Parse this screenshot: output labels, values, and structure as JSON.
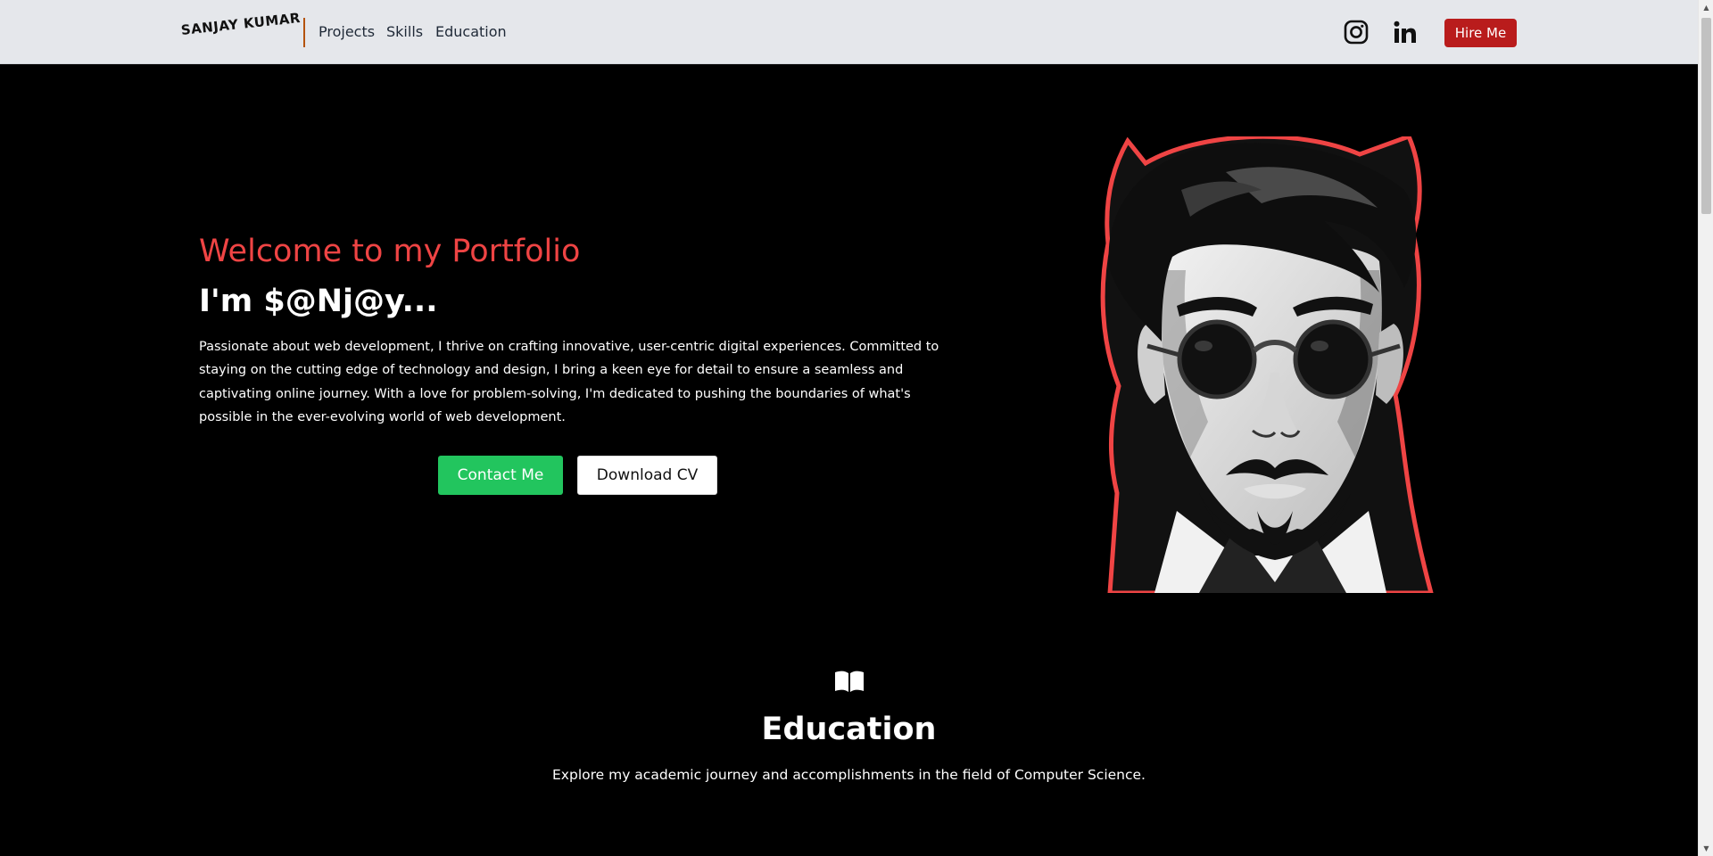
{
  "navbar": {
    "brand": "SANJAY KUMAR",
    "links": [
      {
        "label": "Projects"
      },
      {
        "label": "Skills"
      },
      {
        "label": "Education"
      }
    ],
    "social": [
      {
        "icon": "instagram-icon"
      },
      {
        "icon": "linkedin-icon"
      }
    ],
    "hire_label": "Hire Me",
    "background": "#e5e7eb",
    "hire_color": "#b91c1c"
  },
  "hero": {
    "welcome": "Welcome to my Portfolio",
    "name": "I'm $@Nj@y...",
    "intro": "Passionate about web development, I thrive on crafting innovative, user-centric digital experiences. Committed to staying on the cutting edge of technology and design, I bring a keen eye for detail to ensure a seamless and captivating online journey. With a love for problem-solving, I'm dedicated to pushing the boundaries of what's possible in the ever-evolving world of web development.",
    "contact_label": "Contact Me",
    "cv_label": "Download CV",
    "accent_color": "#ef4444",
    "contact_color": "#22c55e",
    "portrait_icon": "avatar-illustration"
  },
  "education": {
    "icon": "book-open-icon",
    "title": "Education",
    "subtitle": "Explore my academic journey and accomplishments in the field of Computer Science."
  }
}
